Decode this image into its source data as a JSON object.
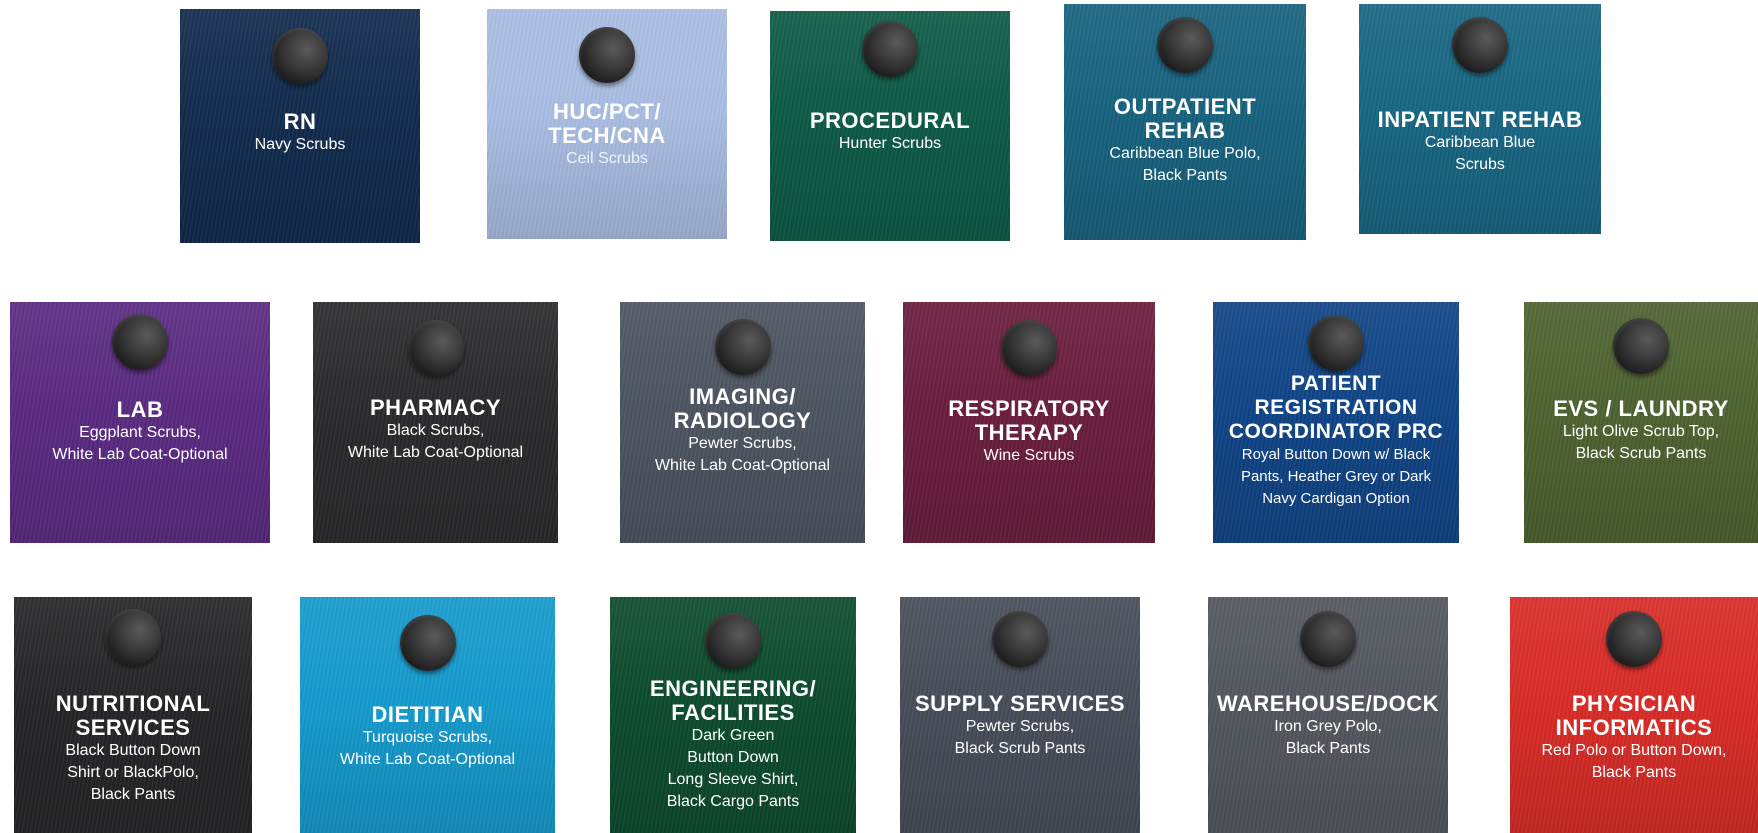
{
  "swatches": [
    {
      "title": "RN",
      "desc": "Navy Scrubs",
      "color": "#112a4d"
    },
    {
      "title": "HUC/PCT/\nTECH/CNA",
      "desc": "Ceil Scrubs",
      "color": "#a9bde3"
    },
    {
      "title": "PROCEDURAL",
      "desc": "Hunter Scrubs",
      "color": "#0c5a45"
    },
    {
      "title": "OUTPATIENT\nREHAB",
      "desc": "Caribbean Blue Polo,\nBlack Pants",
      "color": "#17627f"
    },
    {
      "title": "INPATIENT REHAB",
      "desc": "Caribbean Blue\nScrubs",
      "color": "#176683"
    },
    {
      "title": "LAB",
      "desc": "Eggplant Scrubs,\nWhite Lab Coat-Optional",
      "color": "#5a2a82"
    },
    {
      "title": "PHARMACY",
      "desc": "Black Scrubs,\nWhite Lab Coat-Optional",
      "color": "#2a2a2c"
    },
    {
      "title": "IMAGING/\nRADIOLOGY",
      "desc": "Pewter Scrubs,\nWhite Lab Coat-Optional",
      "color": "#4c5460"
    },
    {
      "title": "RESPIRATORY\nTHERAPY",
      "desc": "Wine Scrubs",
      "color": "#6a1d3c"
    },
    {
      "title": "PATIENT\nREGISTRATION\nCOORDINATOR PRC",
      "desc": "Royal Button Down w/ Black\nPants, Heather Grey or Dark\nNavy Cardigan Option",
      "color": "#0f4486"
    },
    {
      "title": "EVS / LAUNDRY",
      "desc": "Light Olive Scrub Top,\nBlack Scrub Pants",
      "color": "#4d6230"
    },
    {
      "title": "NUTRITIONAL\nSERVICES",
      "desc": "Black Button Down\nShirt or BlackPolo,\nBlack Pants",
      "color": "#252527"
    },
    {
      "title": "DIETITIAN",
      "desc": "Turquoise Scrubs,\nWhite Lab Coat-Optional",
      "color": "#149acd"
    },
    {
      "title": "ENGINEERING/\nFACILITIES",
      "desc": "Dark Green\nButton Down\nLong Sleeve Shirt,\nBlack Cargo Pants",
      "color": "#0c4b2d"
    },
    {
      "title": "SUPPLY SERVICES",
      "desc": "Pewter Scrubs,\nBlack Scrub Pants",
      "color": "#464d58"
    },
    {
      "title": "WAREHOUSE/DOCK",
      "desc": "Iron Grey Polo,\nBlack Pants",
      "color": "#53565e"
    },
    {
      "title": "PHYSICIAN\nINFORMATICS",
      "desc": "Red Polo or Button Down,\nBlack Pants",
      "color": "#d92b26"
    }
  ]
}
